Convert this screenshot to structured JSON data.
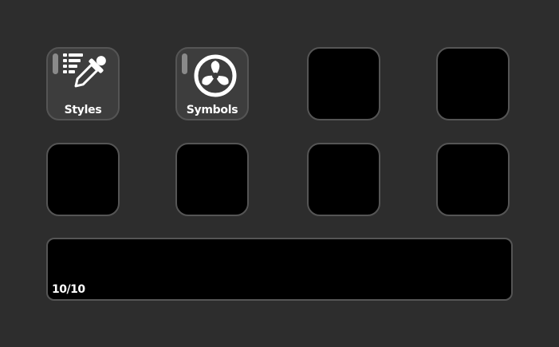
{
  "keys": [
    {
      "label": "Styles",
      "icon": "eyedropper-list-icon"
    },
    {
      "label": "Symbols",
      "icon": "symbols-swirl-icon"
    },
    {
      "label": "",
      "icon": ""
    },
    {
      "label": "",
      "icon": ""
    },
    {
      "label": "",
      "icon": ""
    },
    {
      "label": "",
      "icon": ""
    },
    {
      "label": "",
      "icon": ""
    },
    {
      "label": "",
      "icon": ""
    }
  ],
  "panel": {
    "page_indicator": "10/10"
  },
  "colors": {
    "background": "#2d2d2d",
    "key_empty": "#000000",
    "key_filled": "#3d3d3d",
    "key_border": "#555555",
    "key_indicator": "#8a8a8a",
    "text": "#ffffff"
  }
}
